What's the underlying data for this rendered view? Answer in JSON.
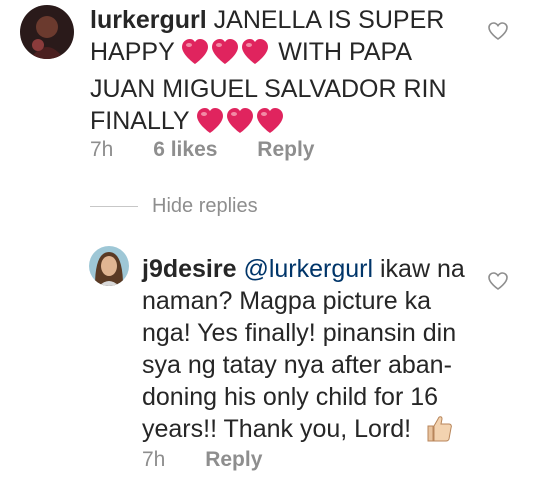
{
  "comments": [
    {
      "username": "lurkergurl",
      "text_parts": [
        "JANELLA IS SUPER",
        "HAPPY",
        "WITH PAPA",
        "JUAN MIGUEL SALVADOR RIN",
        "FINALLY"
      ],
      "time": "7h",
      "likes": "6 likes",
      "reply_label": "Reply"
    }
  ],
  "hide_replies_label": "Hide replies",
  "reply": {
    "username": "j9desire",
    "mention": "@lurkergurl",
    "text_lines": [
      "ikaw na",
      "naman? Magpa picture ka",
      "nga! Yes finally! pinansin din",
      "sya ng tatay nya after aban-",
      "doning his only child for 16",
      "years!! Thank you, Lord!"
    ],
    "time": "7h",
    "reply_label": "Reply"
  },
  "icons": {
    "heart_emoji": "red-heart-icon",
    "thumb_emoji": "thumbs-up-icon",
    "like": "heart-outline-icon"
  },
  "colors": {
    "text": "#262626",
    "meta": "#8e8e8e",
    "heart": "#e0245e",
    "mention": "#003569"
  }
}
